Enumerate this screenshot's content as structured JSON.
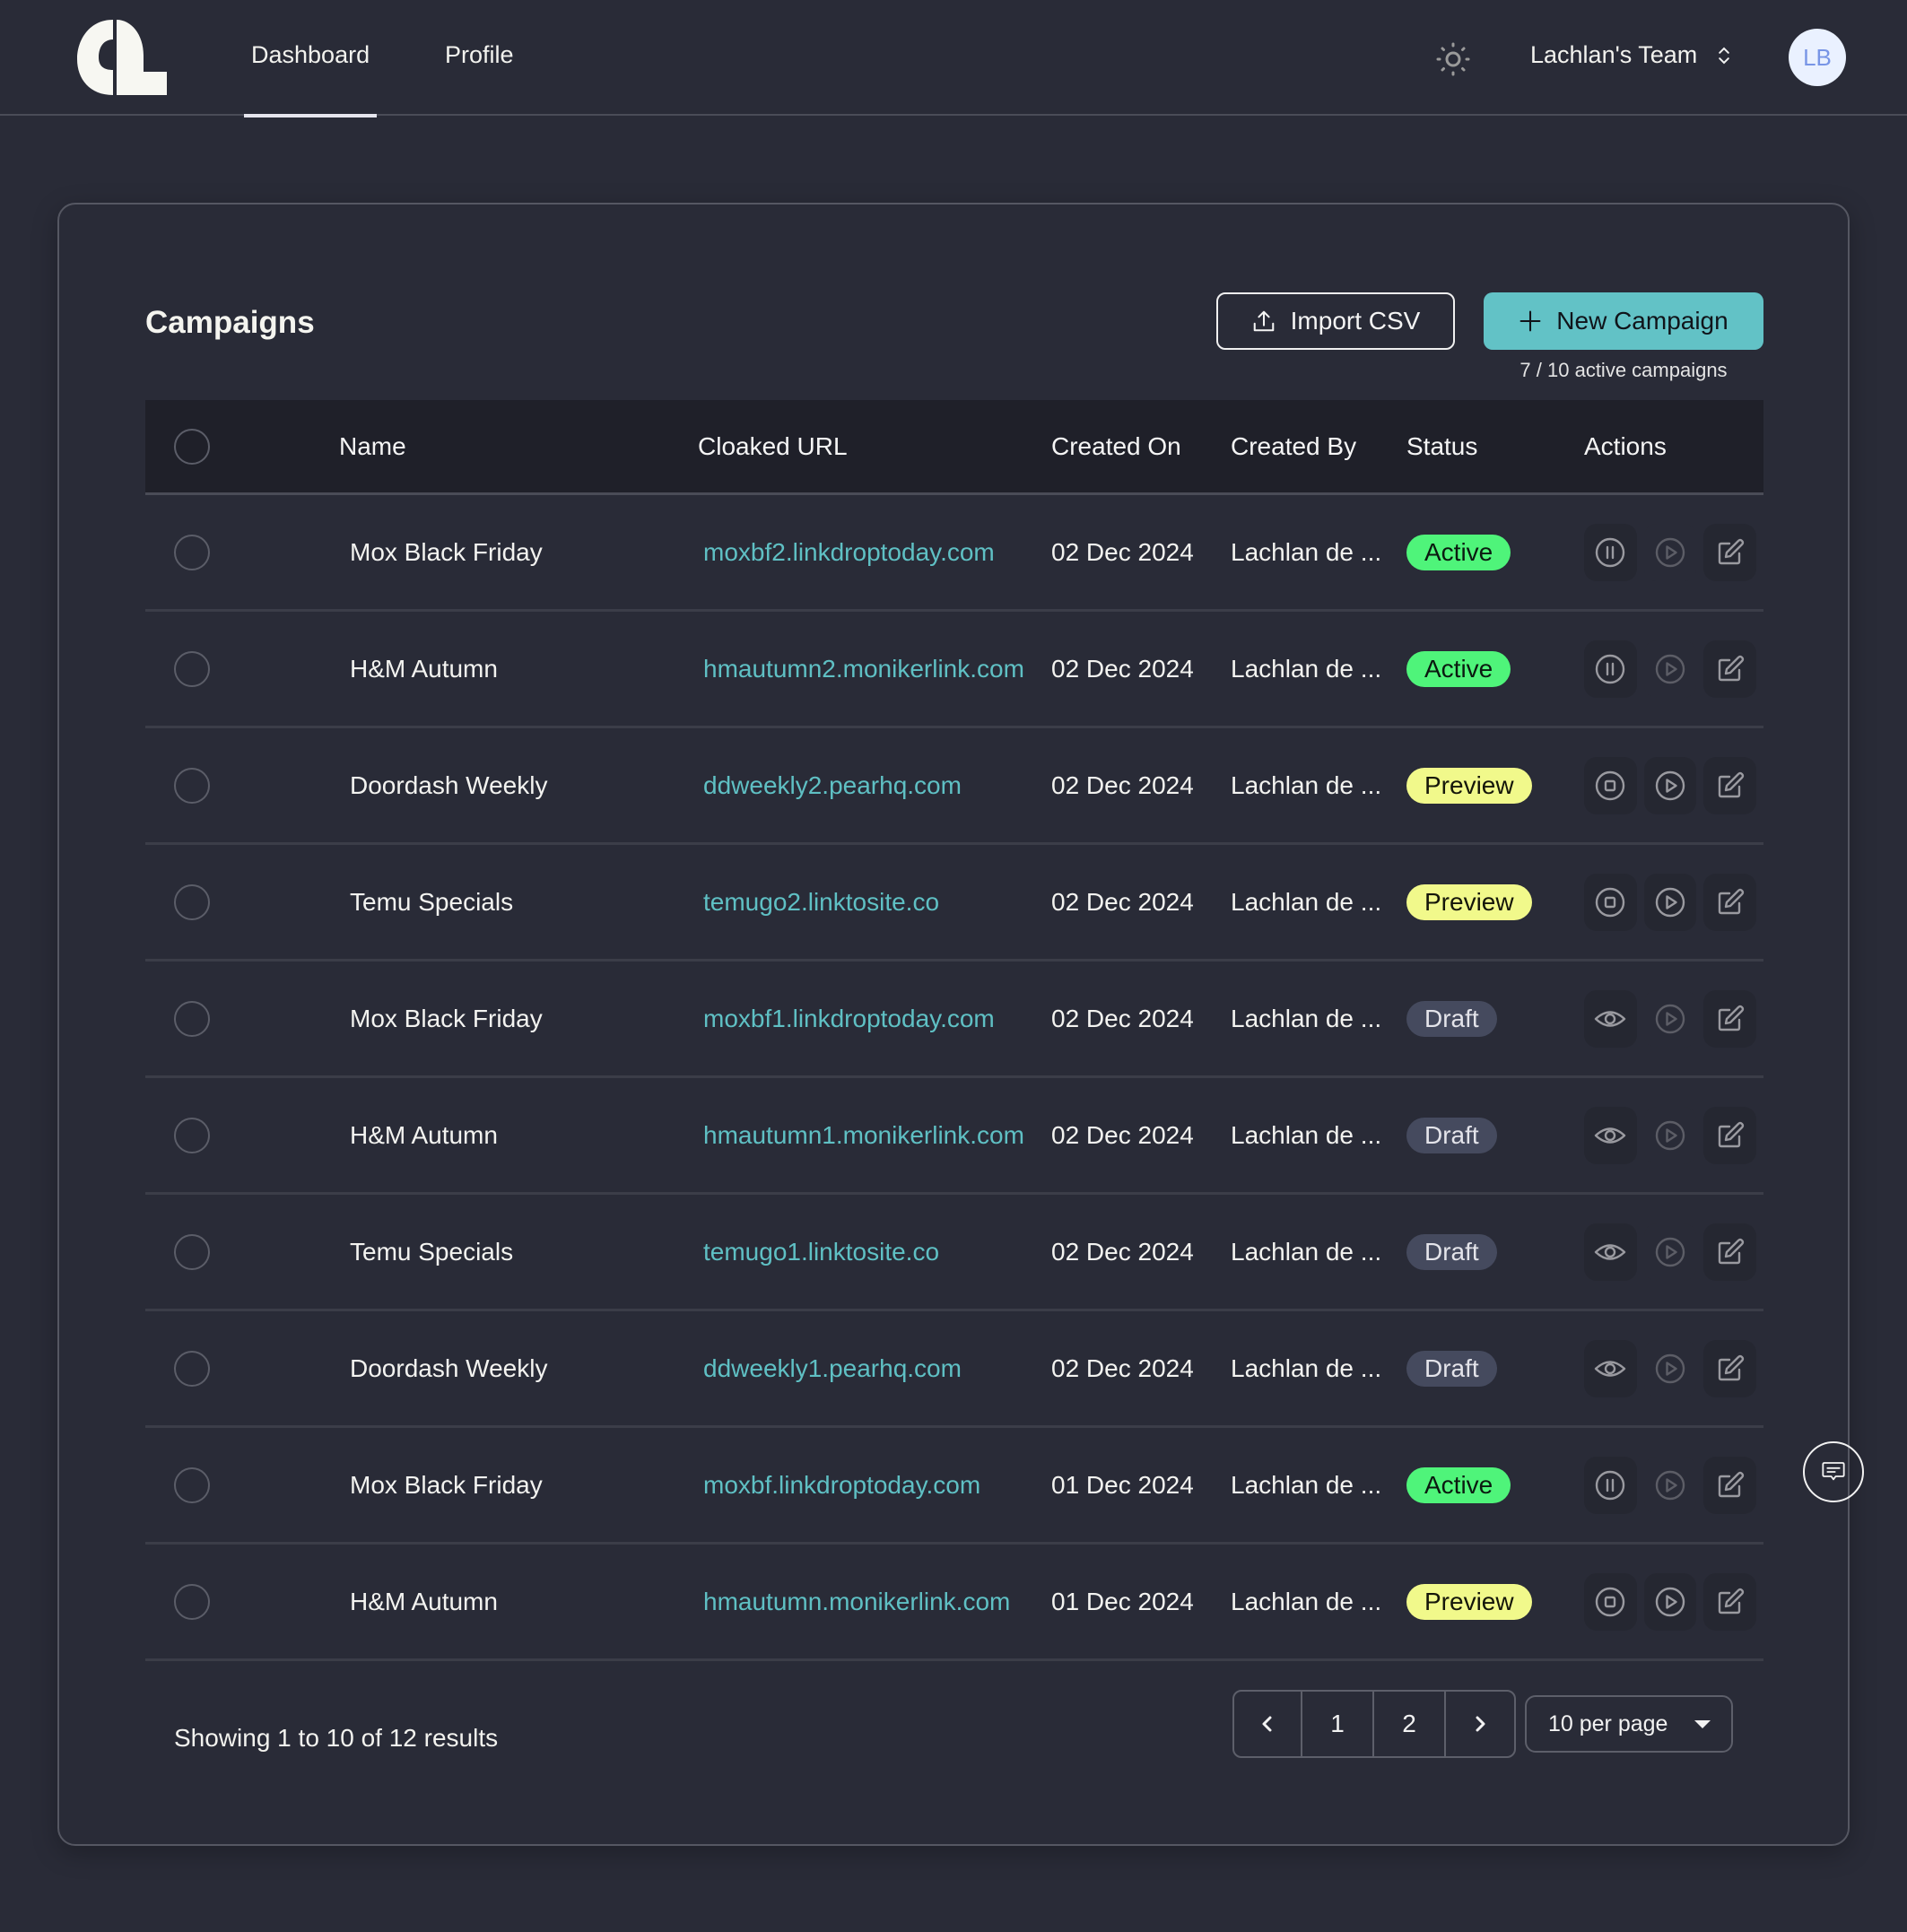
{
  "nav": {
    "logo_alt": "app-logo",
    "tabs": [
      {
        "label": "Dashboard",
        "active": true
      },
      {
        "label": "Profile",
        "active": false
      }
    ],
    "theme_icon": "sun-icon",
    "team": "Lachlan's Team",
    "avatar_initials": "LB"
  },
  "page": {
    "title": "Campaigns",
    "import_label": "Import CSV",
    "new_label": "New Campaign",
    "active_count": "7 / 10 active campaigns"
  },
  "colors": {
    "accent": "#62c2c6",
    "link": "#5fc0c4",
    "active": "#4ff47a",
    "preview": "#f1f98b",
    "draft": "#454a5e",
    "background": "#292b37"
  },
  "table": {
    "headers": [
      "Name",
      "Cloaked URL",
      "Created On",
      "Created By",
      "Status",
      "Actions"
    ],
    "rows": [
      {
        "name": "Mox Black Friday",
        "url": "moxbf2.linkdroptoday.com",
        "date": "02 Dec 2024",
        "by": "Lachlan de ...",
        "status": "Active",
        "kind": "active"
      },
      {
        "name": "H&M Autumn",
        "url": "hmautumn2.monikerlink.com",
        "date": "02 Dec 2024",
        "by": "Lachlan de ...",
        "status": "Active",
        "kind": "active"
      },
      {
        "name": "Doordash Weekly",
        "url": "ddweekly2.pearhq.com",
        "date": "02 Dec 2024",
        "by": "Lachlan de ...",
        "status": "Preview",
        "kind": "preview"
      },
      {
        "name": "Temu Specials",
        "url": "temugo2.linktosite.co",
        "date": "02 Dec 2024",
        "by": "Lachlan de ...",
        "status": "Preview",
        "kind": "preview"
      },
      {
        "name": "Mox Black Friday",
        "url": "moxbf1.linkdroptoday.com",
        "date": "02 Dec 2024",
        "by": "Lachlan de ...",
        "status": "Draft",
        "kind": "draft"
      },
      {
        "name": "H&M Autumn",
        "url": "hmautumn1.monikerlink.com",
        "date": "02 Dec 2024",
        "by": "Lachlan de ...",
        "status": "Draft",
        "kind": "draft"
      },
      {
        "name": "Temu Specials",
        "url": "temugo1.linktosite.co",
        "date": "02 Dec 2024",
        "by": "Lachlan de ...",
        "status": "Draft",
        "kind": "draft"
      },
      {
        "name": "Doordash Weekly",
        "url": "ddweekly1.pearhq.com",
        "date": "02 Dec 2024",
        "by": "Lachlan de ...",
        "status": "Draft",
        "kind": "draft"
      },
      {
        "name": "Mox Black Friday",
        "url": "moxbf.linkdroptoday.com",
        "date": "01 Dec 2024",
        "by": "Lachlan de ...",
        "status": "Active",
        "kind": "active"
      },
      {
        "name": "H&M Autumn",
        "url": "hmautumn.monikerlink.com",
        "date": "01 Dec 2024",
        "by": "Lachlan de ...",
        "status": "Preview",
        "kind": "preview"
      }
    ],
    "actions_by_kind": {
      "active": [
        {
          "icon": "pause-icon",
          "enabled": true
        },
        {
          "icon": "play-icon",
          "enabled": false
        },
        {
          "icon": "edit-icon",
          "enabled": true
        }
      ],
      "preview": [
        {
          "icon": "stop-icon",
          "enabled": true
        },
        {
          "icon": "play-icon",
          "enabled": true
        },
        {
          "icon": "edit-icon",
          "enabled": true
        }
      ],
      "draft": [
        {
          "icon": "eye-icon",
          "enabled": true
        },
        {
          "icon": "play-icon",
          "enabled": false
        },
        {
          "icon": "edit-icon",
          "enabled": true
        }
      ]
    }
  },
  "footer": {
    "results": "Showing 1 to 10 of 12 results",
    "pages": [
      "1",
      "2"
    ],
    "current_page": "1",
    "per_page": "10 per page"
  },
  "chat_icon": "chat-bubble-icon"
}
